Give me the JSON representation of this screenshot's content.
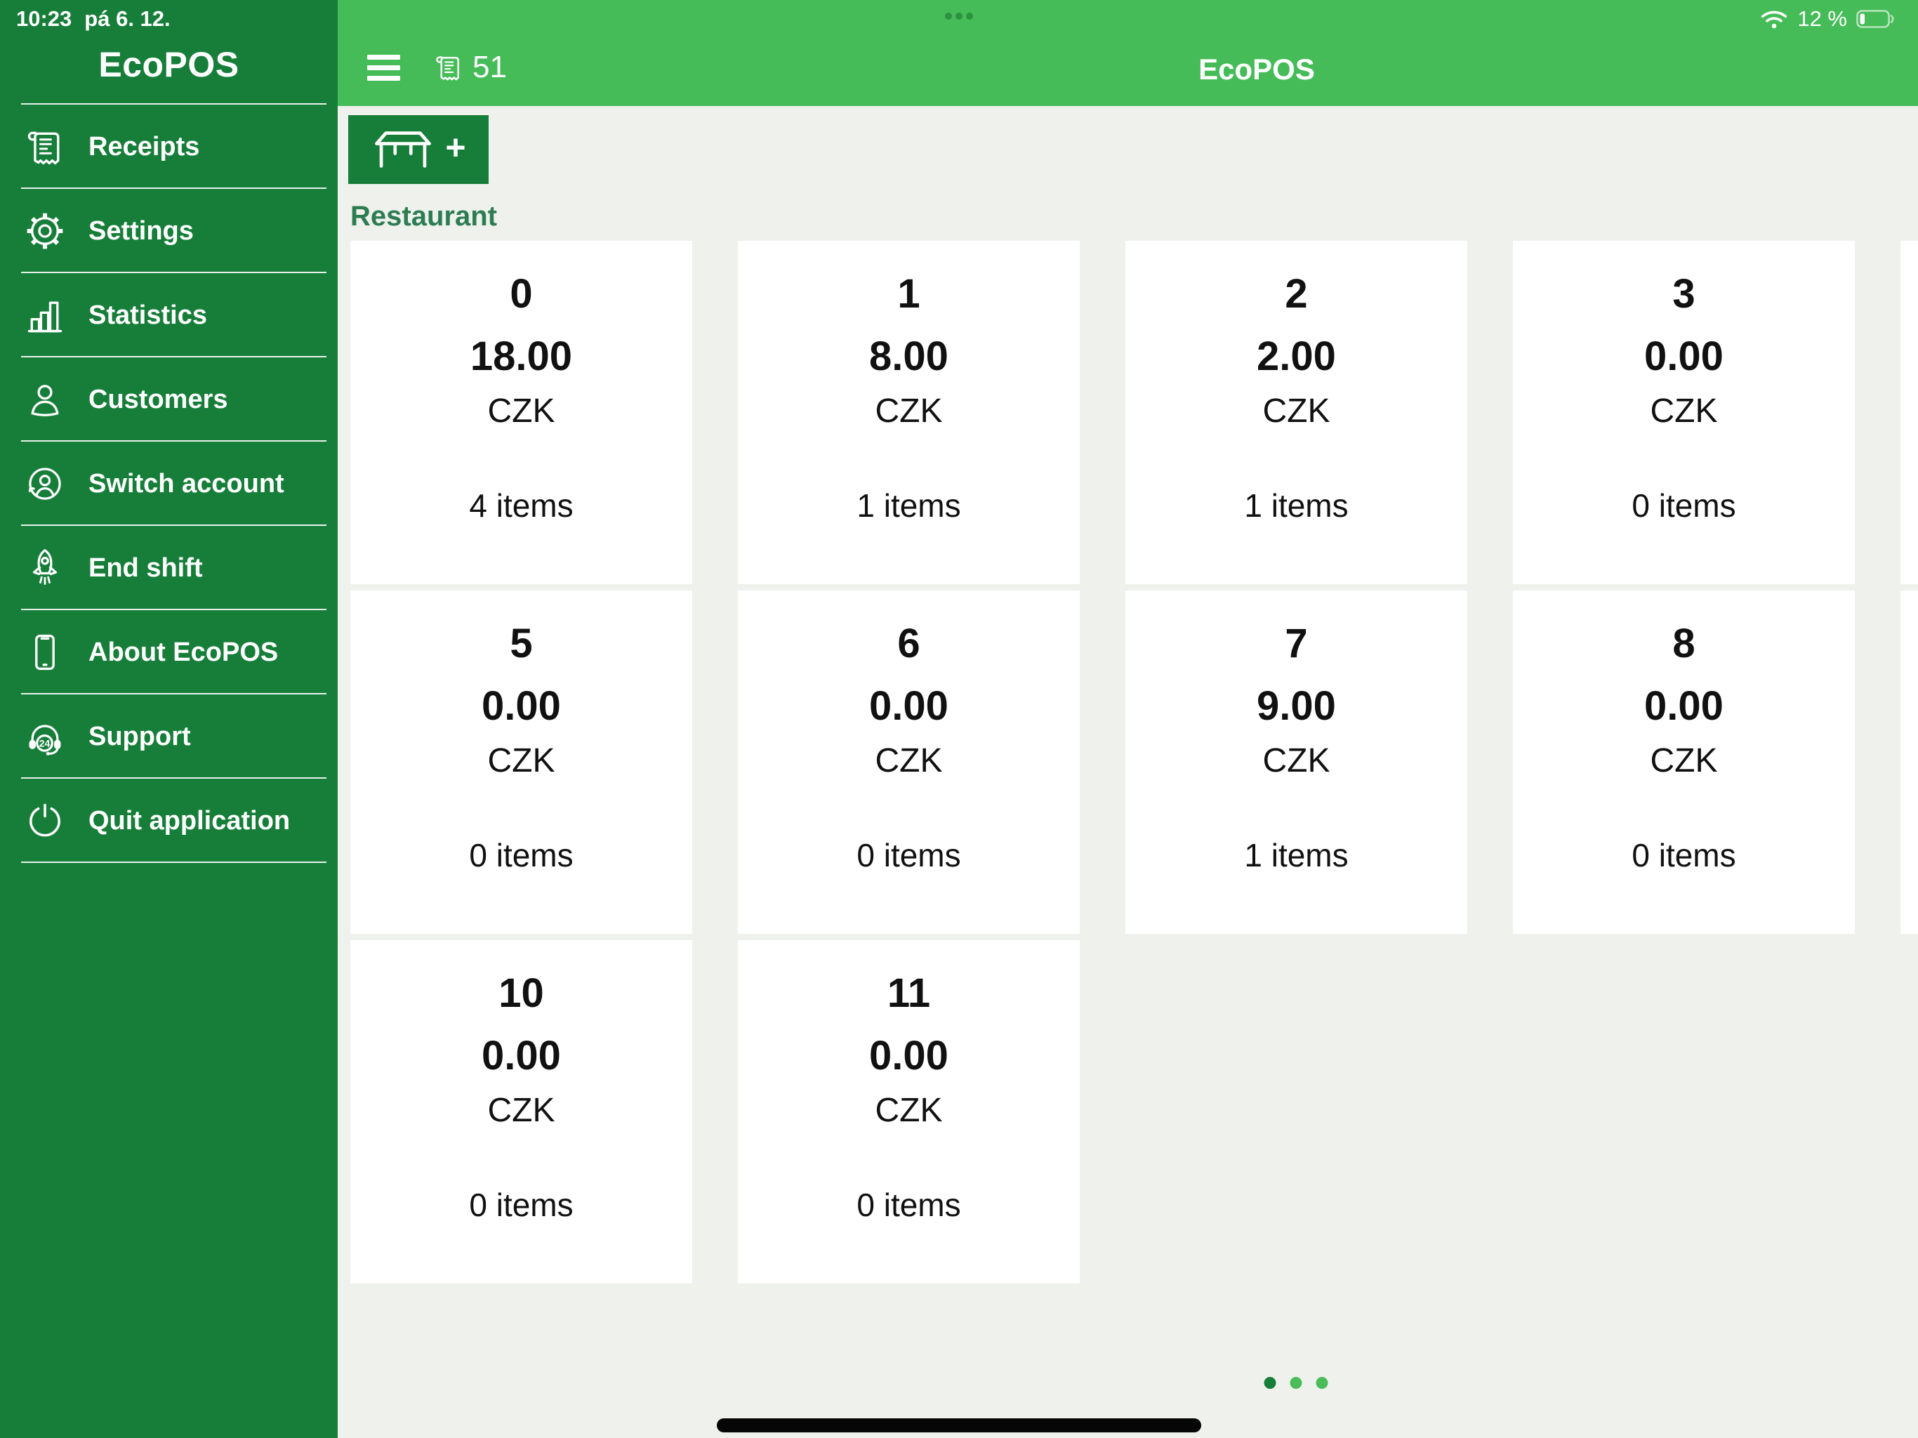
{
  "status_bar": {
    "time": "10:23",
    "date": "pá 6. 12.",
    "battery_label": "12 %",
    "wifi_icon": "wifi-icon",
    "battery_icon": "battery-low-icon",
    "multitask_dots": 3
  },
  "sidebar": {
    "app_title": "EcoPOS",
    "items": [
      {
        "id": "receipts",
        "icon": "receipt-icon",
        "label": "Receipts"
      },
      {
        "id": "settings",
        "icon": "gear-icon",
        "label": "Settings"
      },
      {
        "id": "statistics",
        "icon": "bar-chart-icon",
        "label": "Statistics"
      },
      {
        "id": "customers",
        "icon": "person-icon",
        "label": "Customers"
      },
      {
        "id": "switch-account",
        "icon": "switch-user-icon",
        "label": "Switch account"
      },
      {
        "id": "end-shift",
        "icon": "rocket-icon",
        "label": "End shift"
      },
      {
        "id": "about-ecopos",
        "icon": "tablet-icon",
        "label": "About EcoPOS"
      },
      {
        "id": "support",
        "icon": "headset-24-icon",
        "label": "Support"
      },
      {
        "id": "quit",
        "icon": "power-icon",
        "label": "Quit application"
      }
    ]
  },
  "top_bar": {
    "title": "EcoPOS",
    "hamburger_icon": "hamburger-menu-icon",
    "receipt_icon": "receipt-icon",
    "receipt_count": "51"
  },
  "content": {
    "add_table_button": {
      "icon": "table-icon",
      "plus_label": "+"
    },
    "section_label": "Restaurant",
    "tables": [
      {
        "row": 0,
        "col": 0,
        "number": "0",
        "amount": "18.00",
        "currency": "CZK",
        "items": "4 items"
      },
      {
        "row": 0,
        "col": 1,
        "number": "1",
        "amount": "8.00",
        "currency": "CZK",
        "items": "1 items"
      },
      {
        "row": 0,
        "col": 2,
        "number": "2",
        "amount": "2.00",
        "currency": "CZK",
        "items": "1 items"
      },
      {
        "row": 0,
        "col": 3,
        "number": "3",
        "amount": "0.00",
        "currency": "CZK",
        "items": "0 items"
      },
      {
        "row": 1,
        "col": 0,
        "number": "5",
        "amount": "0.00",
        "currency": "CZK",
        "items": "0 items"
      },
      {
        "row": 1,
        "col": 1,
        "number": "6",
        "amount": "0.00",
        "currency": "CZK",
        "items": "0 items"
      },
      {
        "row": 1,
        "col": 2,
        "number": "7",
        "amount": "9.00",
        "currency": "CZK",
        "items": "1 items"
      },
      {
        "row": 1,
        "col": 3,
        "number": "8",
        "amount": "0.00",
        "currency": "CZK",
        "items": "0 items"
      },
      {
        "row": 2,
        "col": 0,
        "number": "10",
        "amount": "0.00",
        "currency": "CZK",
        "items": "0 items"
      },
      {
        "row": 2,
        "col": 1,
        "number": "11",
        "amount": "0.00",
        "currency": "CZK",
        "items": "0 items"
      }
    ],
    "partial_next_page_cards": [
      {
        "row": 0,
        "col": 4
      },
      {
        "row": 1,
        "col": 4
      }
    ]
  },
  "pagination": {
    "count": 3,
    "active_index": 0
  },
  "colors": {
    "brand_dark_green": "#177E3A",
    "topbar_green": "#45BC57",
    "content_background": "#EEF1EC",
    "card_background": "#FFFFFF",
    "section_label_green": "#2E7D52",
    "card_text": "#111111",
    "pagination_active": "#177E3A",
    "pagination_inactive": "#4BBC57"
  }
}
